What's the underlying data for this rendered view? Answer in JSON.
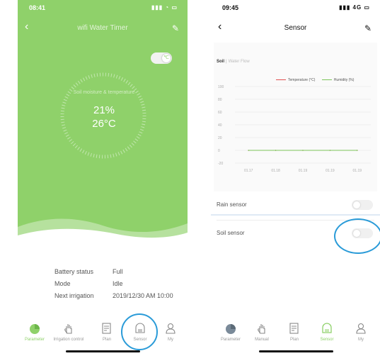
{
  "phone1": {
    "status_bar": {
      "time": "08:41",
      "icons": "▮▮▮ ◔ ▭"
    },
    "header": {
      "back": "‹",
      "title": "wifi Water Timer",
      "edit": "✎"
    },
    "toggle": {
      "knob_glyph": "℃"
    },
    "gauge": {
      "label": "Soil moisture & temperature",
      "moisture": "21%",
      "temperature": "26°C"
    },
    "status_rows": [
      {
        "key": "Battery status",
        "value": "Full"
      },
      {
        "key": "Mode",
        "value": "Idle"
      },
      {
        "key": "Next irrigation",
        "value": "2019/12/30 AM 10:00"
      }
    ],
    "tabs": [
      {
        "label": "Parameter",
        "icon": "pie-chart-icon"
      },
      {
        "label": "Irrigation control",
        "icon": "hand-icon"
      },
      {
        "label": "Plan",
        "icon": "document-icon"
      },
      {
        "label": "Sensor",
        "icon": "sensor-icon"
      },
      {
        "label": "My",
        "icon": "person-icon"
      }
    ],
    "colors": {
      "accent": "#8fd16a",
      "highlight_circle": "#2a9bd8"
    }
  },
  "phone2": {
    "status_bar": {
      "time": "09:45",
      "icons": "▮▮▮ 4G ▭"
    },
    "header": {
      "back": "‹",
      "title": "Sensor",
      "edit": "✎"
    },
    "tabs_top": {
      "soil": "Soil",
      "separator": "|",
      "water": "Water Flow"
    },
    "rows": [
      {
        "label": "Rain sensor"
      },
      {
        "label": "Soil sensor"
      }
    ],
    "tabs": [
      {
        "label": "Parameter",
        "icon": "pie-chart-icon"
      },
      {
        "label": "Manual",
        "icon": "hand-icon"
      },
      {
        "label": "Plan",
        "icon": "document-icon"
      },
      {
        "label": "Sensor",
        "icon": "sensor-icon"
      },
      {
        "label": "My",
        "icon": "person-icon"
      }
    ]
  },
  "chart_data": {
    "type": "line",
    "x": [
      "01.17",
      "01.18",
      "01.19",
      "01.19",
      "01.19"
    ],
    "series": [
      {
        "name": "Temperature (°C)",
        "color": "#e05050",
        "values": [
          0,
          0,
          0,
          0,
          0
        ]
      },
      {
        "name": "Humidity (%)",
        "color": "#7cc45a",
        "values": [
          0,
          0,
          0,
          0,
          0
        ]
      }
    ],
    "y_ticks": [
      100,
      80,
      60,
      40,
      20,
      0,
      -20
    ],
    "ylim": [
      -20,
      100
    ],
    "grid": true,
    "legend": "top-right"
  }
}
